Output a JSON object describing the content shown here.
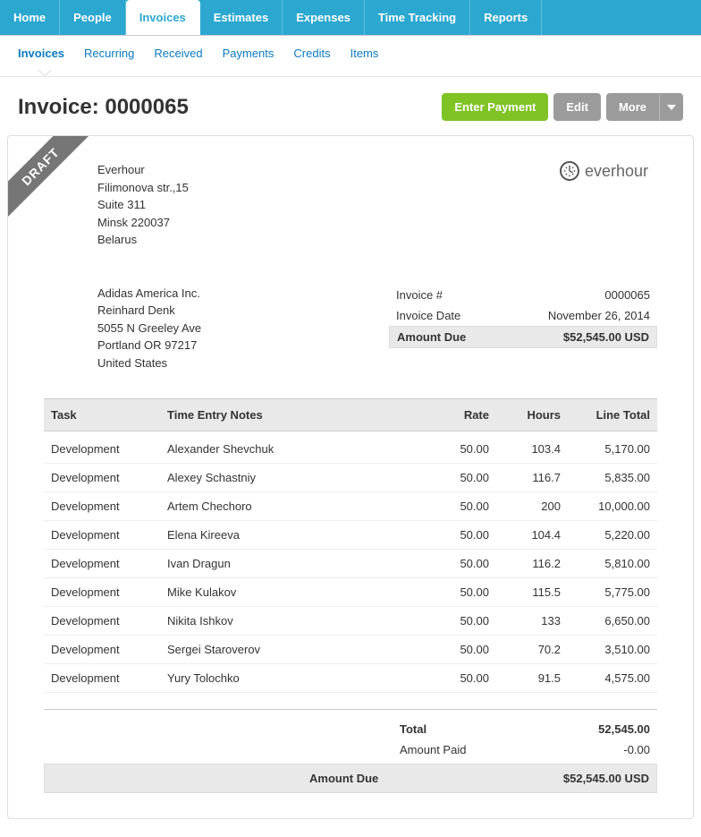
{
  "topTabs": [
    "Home",
    "People",
    "Invoices",
    "Estimates",
    "Expenses",
    "Time Tracking",
    "Reports"
  ],
  "topTabActiveIndex": 2,
  "subTabs": [
    "Invoices",
    "Recurring",
    "Received",
    "Payments",
    "Credits",
    "Items"
  ],
  "subTabActiveIndex": 0,
  "pageTitlePrefix": "Invoice: ",
  "pageTitleNumber": "0000065",
  "buttons": {
    "enterPayment": "Enter Payment",
    "edit": "Edit",
    "more": "More"
  },
  "draftLabel": "DRAFT",
  "sender": {
    "name": "Everhour",
    "street": "Filimonova str.,15",
    "suite": "Suite 311",
    "cityZip": "Minsk  220037",
    "country": "Belarus"
  },
  "logoText": "everhour",
  "client": {
    "name": "Adidas America Inc.",
    "contact": "Reinhard Denk",
    "street": "5055 N Greeley Ave",
    "cityZip": "Portland OR  97217",
    "country": "United States"
  },
  "meta": {
    "invoiceNumLabel": "Invoice #",
    "invoiceNum": "0000065",
    "invoiceDateLabel": "Invoice Date",
    "invoiceDate": "November 26, 2014",
    "amountDueLabel": "Amount Due",
    "amountDue": "$52,545.00 USD"
  },
  "columns": {
    "task": "Task",
    "notes": "Time Entry Notes",
    "rate": "Rate",
    "hours": "Hours",
    "lineTotal": "Line Total"
  },
  "lineItems": [
    {
      "task": "Development",
      "notes": "Alexander Shevchuk",
      "rate": "50.00",
      "hours": "103.4",
      "total": "5,170.00"
    },
    {
      "task": "Development",
      "notes": "Alexey Schastniy",
      "rate": "50.00",
      "hours": "116.7",
      "total": "5,835.00"
    },
    {
      "task": "Development",
      "notes": "Artem Chechoro",
      "rate": "50.00",
      "hours": "200",
      "total": "10,000.00"
    },
    {
      "task": "Development",
      "notes": "Elena Kireeva",
      "rate": "50.00",
      "hours": "104.4",
      "total": "5,220.00"
    },
    {
      "task": "Development",
      "notes": "Ivan Dragun",
      "rate": "50.00",
      "hours": "116.2",
      "total": "5,810.00"
    },
    {
      "task": "Development",
      "notes": "Mike Kulakov",
      "rate": "50.00",
      "hours": "115.5",
      "total": "5,775.00"
    },
    {
      "task": "Development",
      "notes": "Nikita Ishkov",
      "rate": "50.00",
      "hours": "133",
      "total": "6,650.00"
    },
    {
      "task": "Development",
      "notes": "Sergei Staroverov",
      "rate": "50.00",
      "hours": "70.2",
      "total": "3,510.00"
    },
    {
      "task": "Development",
      "notes": "Yury Tolochko",
      "rate": "50.00",
      "hours": "91.5",
      "total": "4,575.00"
    }
  ],
  "totals": {
    "totalLabel": "Total",
    "total": "52,545.00",
    "amountPaidLabel": "Amount Paid",
    "amountPaid": "-0.00",
    "amountDueLabel": "Amount Due",
    "amountDue": "$52,545.00 USD"
  }
}
